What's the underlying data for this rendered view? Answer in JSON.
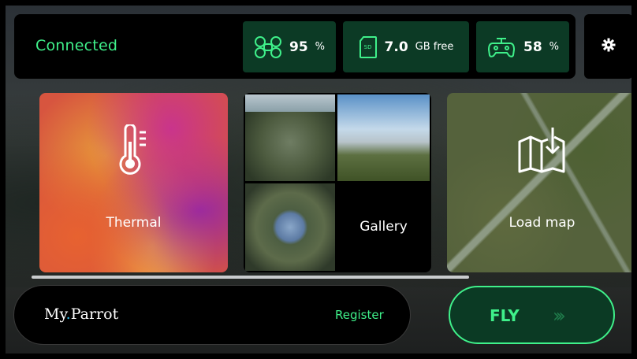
{
  "status": {
    "connection": "Connected",
    "drone_battery": {
      "value": "95",
      "unit": "%"
    },
    "storage": {
      "value": "7.0",
      "unit": "GB free",
      "icon_text": "SD"
    },
    "controller_battery": {
      "value": "58",
      "unit": "%"
    }
  },
  "tiles": {
    "thermal": "Thermal",
    "gallery": "Gallery",
    "load_map": "Load map"
  },
  "footer": {
    "brand_name_1": "My",
    "brand_dot": ".",
    "brand_name_2": "Parrot",
    "register": "Register",
    "fly": "FLY",
    "fly_chevrons": "›››"
  },
  "colors": {
    "accent": "#3ff08a",
    "pill_bg": "#0c3a25",
    "fly_bg": "#0b3a24"
  },
  "icons": [
    "drone-icon",
    "sd-card-icon",
    "controller-icon",
    "gear-icon",
    "thermometer-icon",
    "map-download-icon"
  ]
}
